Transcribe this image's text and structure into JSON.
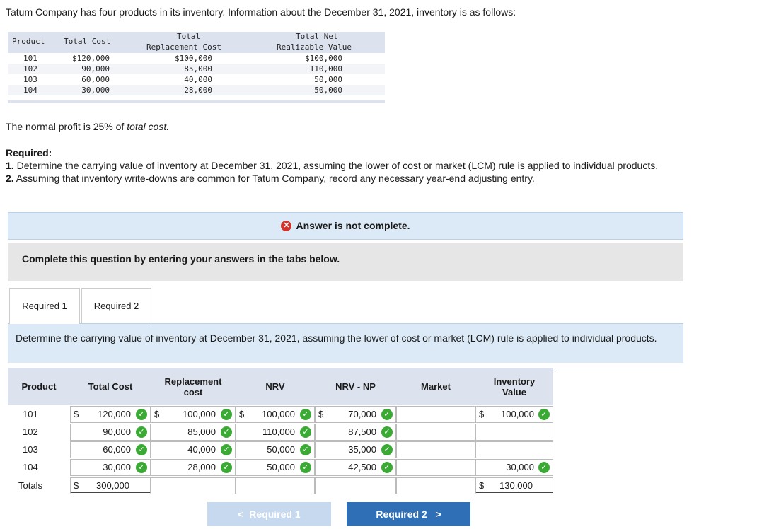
{
  "intro": "Tatum Company has four products in its inventory. Information about the December 31, 2021, inventory is as follows:",
  "info_table": {
    "headers": {
      "product": "Product",
      "total_cost": "Total Cost",
      "replacement_l1": "Total",
      "replacement_l2": "Replacement Cost",
      "nrv_l1": "Total Net",
      "nrv_l2": "Realizable Value"
    },
    "rows": [
      {
        "product": "101",
        "total_cost": "$120,000",
        "replacement": "$100,000",
        "nrv": "$100,000"
      },
      {
        "product": "102",
        "total_cost": "90,000",
        "replacement": "85,000",
        "nrv": "110,000"
      },
      {
        "product": "103",
        "total_cost": "60,000",
        "replacement": "40,000",
        "nrv": "50,000"
      },
      {
        "product": "104",
        "total_cost": "30,000",
        "replacement": "28,000",
        "nrv": "50,000"
      }
    ]
  },
  "profit_text_a": "The normal profit is 25% of ",
  "profit_text_b": "total cost.",
  "required_title": "Required:",
  "req1_num": "1.",
  "req1_text": " Determine the carrying value of inventory at December 31, 2021, assuming the lower of cost or market (LCM) rule is applied to individual products.",
  "req2_num": "2.",
  "req2_text": " Assuming that inventory write-downs are common for Tatum Company, record any necessary year-end adjusting entry.",
  "banner": "Answer is not complete.",
  "complete_text": "Complete this question by entering your answers in the tabs below.",
  "tabs": [
    "Required 1",
    "Required 2"
  ],
  "instruction": "Determine the carrying value of inventory at December 31, 2021, assuming the lower of cost or market (LCM) rule is applied to individual products.",
  "grid": {
    "headers": {
      "product": "Product",
      "total_cost": "Total Cost",
      "replacement_l1": "Replacement",
      "replacement_l2": "cost",
      "nrv": "NRV",
      "nrv_np": "NRV - NP",
      "market": "Market",
      "inv_l1": "Inventory",
      "inv_l2": "Value"
    },
    "currency": "$",
    "rows": [
      {
        "product": "101",
        "total_cost": "120,000",
        "replacement": "100,000",
        "nrv": "100,000",
        "nrv_np": "70,000",
        "market": "",
        "inventory": "100,000"
      },
      {
        "product": "102",
        "total_cost": "90,000",
        "replacement": "85,000",
        "nrv": "110,000",
        "nrv_np": "87,500",
        "market": "",
        "inventory": ""
      },
      {
        "product": "103",
        "total_cost": "60,000",
        "replacement": "40,000",
        "nrv": "50,000",
        "nrv_np": "35,000",
        "market": "",
        "inventory": ""
      },
      {
        "product": "104",
        "total_cost": "30,000",
        "replacement": "28,000",
        "nrv": "50,000",
        "nrv_np": "42,500",
        "market": "",
        "inventory": "30,000"
      }
    ],
    "totals": {
      "label": "Totals",
      "total_cost": "300,000",
      "inventory": "130,000"
    }
  },
  "nav": {
    "prev": "Required 1",
    "next": "Required 2"
  }
}
